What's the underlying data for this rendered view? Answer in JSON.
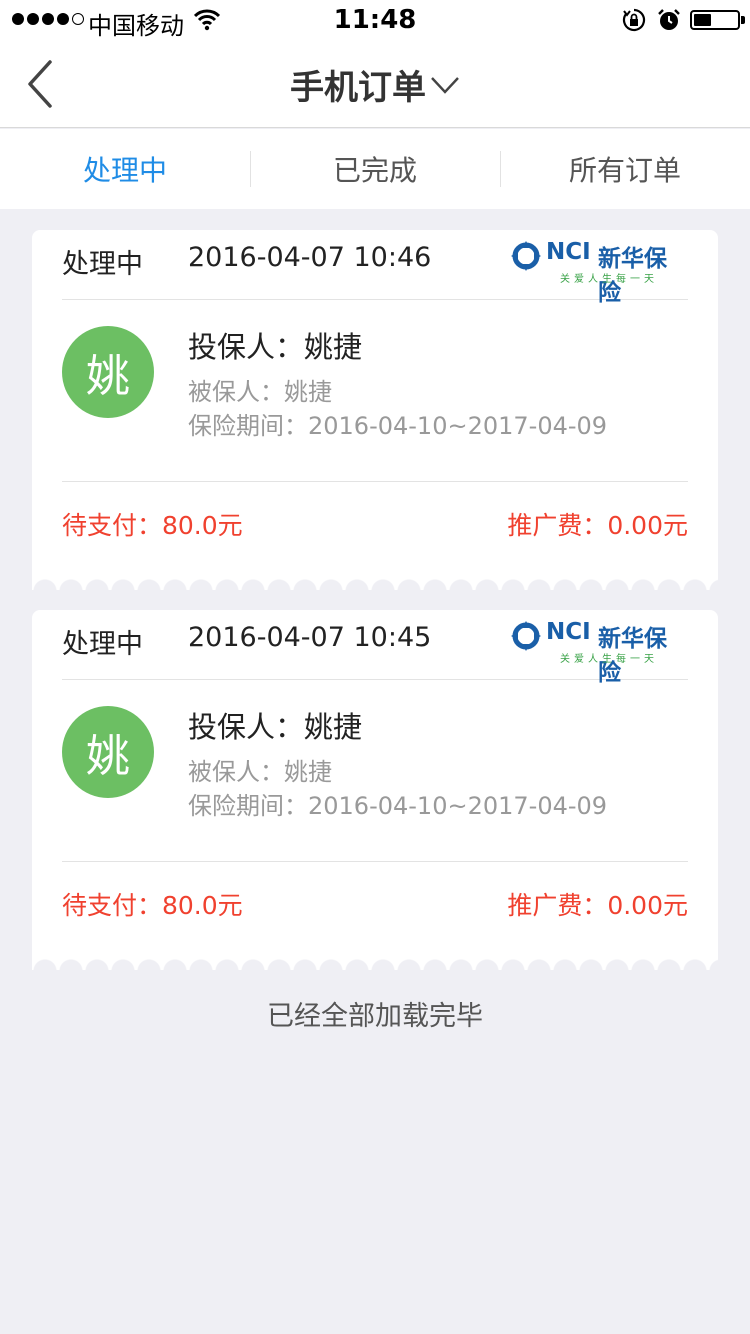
{
  "status_bar": {
    "carrier": "中国移动",
    "time": "11:48",
    "signal_icon": "signal-dots-icon",
    "wifi_icon": "wifi-icon",
    "lock_icon": "rotation-lock-icon",
    "alarm_icon": "alarm-icon",
    "battery_icon": "battery-icon",
    "battery_level": 0.4
  },
  "nav": {
    "title": "手机订单",
    "back_icon": "chevron-left-icon",
    "dropdown_icon": "chevron-down-icon"
  },
  "tabs": [
    {
      "label": "处理中",
      "active": true
    },
    {
      "label": "已完成",
      "active": false
    },
    {
      "label": "所有订单",
      "active": false
    }
  ],
  "colors": {
    "accent": "#1f8ce6",
    "alert": "#f0412f",
    "avatar": "#6cbf63",
    "background": "#efeff4",
    "logo_blue": "#1a5fa8",
    "logo_green": "#3aa348"
  },
  "orders": [
    {
      "status": "处理中",
      "time": "2016-04-07 10:46",
      "logo": {
        "en": "NCI",
        "cn": "新华保险",
        "slogan": "关爱人生每一天"
      },
      "avatar_char": "姚",
      "applicant": "投保人：姚捷",
      "insured": "被保人：姚捷",
      "period": "保险期间：2016-04-10~2017-04-09",
      "pay": "待支付：80.0元",
      "fee": "推广费：0.00元"
    },
    {
      "status": "处理中",
      "time": "2016-04-07 10:45",
      "logo": {
        "en": "NCI",
        "cn": "新华保险",
        "slogan": "关爱人生每一天"
      },
      "avatar_char": "姚",
      "applicant": "投保人：姚捷",
      "insured": "被保人：姚捷",
      "period": "保险期间：2016-04-10~2017-04-09",
      "pay": "待支付：80.0元",
      "fee": "推广费：0.00元"
    }
  ],
  "footer_text": "已经全部加载完毕"
}
